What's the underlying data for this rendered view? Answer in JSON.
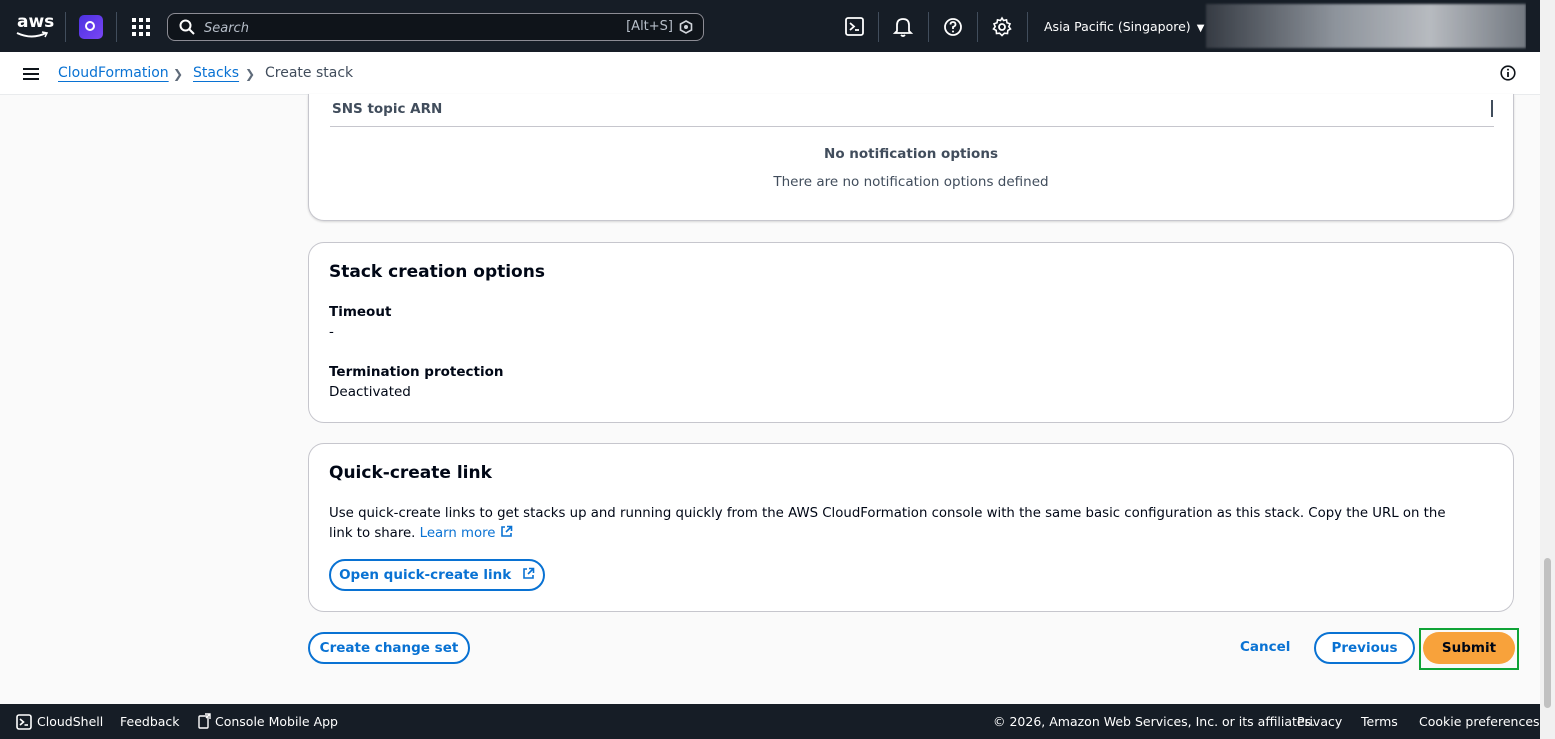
{
  "topnav": {
    "logo_text": "aws",
    "search_placeholder": "Search",
    "search_shortcut": "[Alt+S]",
    "region": "Asia Pacific (Singapore)",
    "icons": [
      "cloudshell-icon",
      "bell-icon",
      "help-icon",
      "gear-icon"
    ]
  },
  "breadcrumb": {
    "items": [
      "CloudFormation",
      "Stacks",
      "Create stack"
    ]
  },
  "notifications": {
    "column_header": "SNS topic ARN",
    "empty_title": "No notification options",
    "empty_description": "There are no notification options defined"
  },
  "stack_creation": {
    "title": "Stack creation options",
    "timeout_label": "Timeout",
    "timeout_value": "-",
    "termination_label": "Termination protection",
    "termination_value": "Deactivated"
  },
  "quick_create": {
    "title": "Quick-create link",
    "description": "Use quick-create links to get stacks up and running quickly from the AWS CloudFormation console with the same basic configuration as this stack. Copy the URL on the link to share.",
    "learn_more": "Learn more",
    "open_button": "Open quick-create link"
  },
  "actions": {
    "create_change_set": "Create change set",
    "cancel": "Cancel",
    "previous": "Previous",
    "submit": "Submit"
  },
  "footer": {
    "cloudshell": "CloudShell",
    "feedback": "Feedback",
    "mobile_app": "Console Mobile App",
    "copyright": "© 2026, Amazon Web Services, Inc. or its affiliates.",
    "privacy": "Privacy",
    "terms": "Terms",
    "cookies": "Cookie preferences"
  },
  "colors": {
    "nav_bg": "#161d26",
    "link": "#0972d3",
    "primary_button": "#f8a23b",
    "highlight_outline": "#0fa336"
  }
}
